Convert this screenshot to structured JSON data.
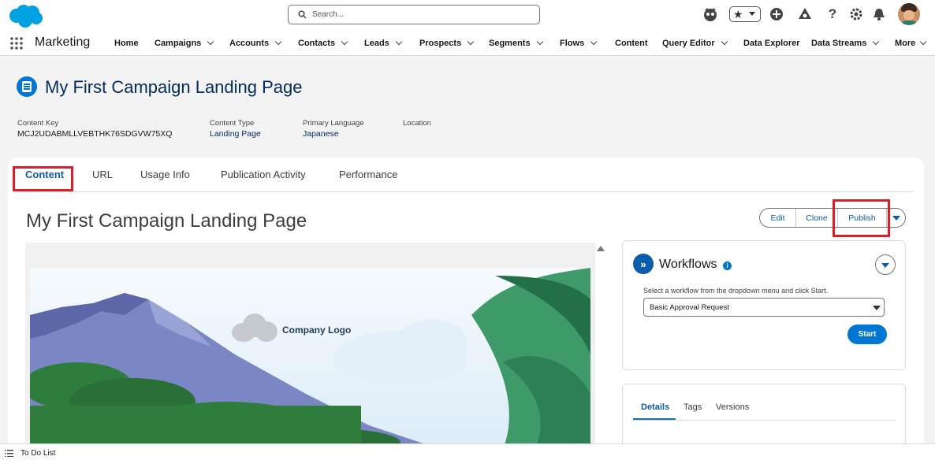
{
  "header": {
    "search_placeholder": "Search...",
    "icons": [
      "agent-icon",
      "favorites-star-icon",
      "add-icon",
      "trailhead-icon",
      "help-icon",
      "settings-gear-icon",
      "notifications-bell-icon",
      "user-avatar"
    ]
  },
  "nav": {
    "app_name": "Marketing",
    "items": [
      {
        "label": "Home",
        "dropdown": false
      },
      {
        "label": "Campaigns",
        "dropdown": true
      },
      {
        "label": "Accounts",
        "dropdown": true
      },
      {
        "label": "Contacts",
        "dropdown": true
      },
      {
        "label": "Leads",
        "dropdown": true
      },
      {
        "label": "Prospects",
        "dropdown": true
      },
      {
        "label": "Segments",
        "dropdown": true
      },
      {
        "label": "Flows",
        "dropdown": true
      },
      {
        "label": "Content",
        "dropdown": false
      },
      {
        "label": "Query Editor",
        "dropdown": true
      },
      {
        "label": "Data Explorer",
        "dropdown": false
      },
      {
        "label": "Data Streams",
        "dropdown": true
      },
      {
        "label": "More",
        "dropdown": true
      }
    ]
  },
  "record": {
    "title": "My First Campaign Landing Page",
    "fields": [
      {
        "label": "Content Key",
        "value": "MCJ2UDABMLLVEBTHK76SDGVW75XQ"
      },
      {
        "label": "Content Type",
        "value": "Landing Page",
        "link": true
      },
      {
        "label": "Primary Language",
        "value": "Japanese",
        "link": true
      },
      {
        "label": "Location",
        "value": ""
      }
    ]
  },
  "tabs": [
    {
      "label": "Content",
      "active": true
    },
    {
      "label": "URL",
      "active": false
    },
    {
      "label": "Usage Info",
      "active": false
    },
    {
      "label": "Publication Activity",
      "active": false
    },
    {
      "label": "Performance",
      "active": false
    }
  ],
  "content": {
    "heading": "My First Campaign Landing Page",
    "actions": {
      "edit": "Edit",
      "clone": "Clone",
      "publish": "Publish"
    },
    "preview": {
      "logo_text": "Company Logo"
    }
  },
  "workflows": {
    "title": "Workflows",
    "instruction": "Select a workflow from the dropdown menu and click Start.",
    "selected": "Basic Approval Request",
    "start": "Start"
  },
  "details_panel": {
    "tabs": [
      {
        "label": "Details",
        "active": true
      },
      {
        "label": "Tags",
        "active": false
      },
      {
        "label": "Versions",
        "active": false
      }
    ]
  },
  "footer": {
    "todo": "To Do List"
  },
  "colors": {
    "brand_blue": "#0176d3",
    "link_blue": "#0b5cab",
    "highlight_red": "#d8202a",
    "title_navy": "#032d60"
  }
}
